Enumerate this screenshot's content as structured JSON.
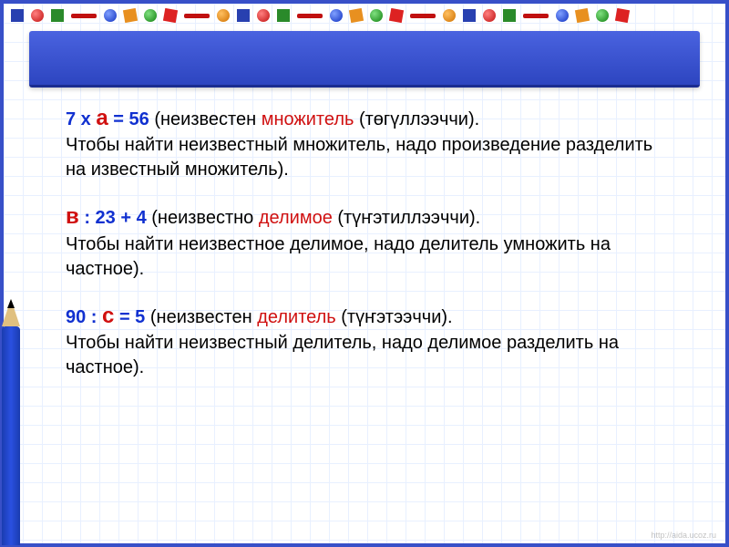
{
  "blocks": [
    {
      "eq_left": "7 х ",
      "eq_var": "а",
      "eq_right": " = 56",
      "open": " (неизвестен ",
      "term": "множитель",
      "term_after": " (төгүллээччи).",
      "body": "Чтобы найти неизвестный множитель, надо произведение разделить на известный множитель)."
    },
    {
      "eq_left": "",
      "eq_var": "в",
      "eq_right": " : 23 + 4",
      "open": " (неизвестно ",
      "term": "делимое",
      "term_after": " (түҥэтиллээччи).",
      "body": "Чтобы найти неизвестное делимое, надо делитель умножить на частное)."
    },
    {
      "eq_left": "90 : ",
      "eq_var": "с",
      "eq_right": " = 5",
      "open": " (неизвестен ",
      "term": "делитель",
      "term_after": " (түҥэтээччи).",
      "body": "Чтобы найти неизвестный делитель, надо делимое разделить на частное)."
    }
  ],
  "watermark": "http://aida.ucoz.ru"
}
